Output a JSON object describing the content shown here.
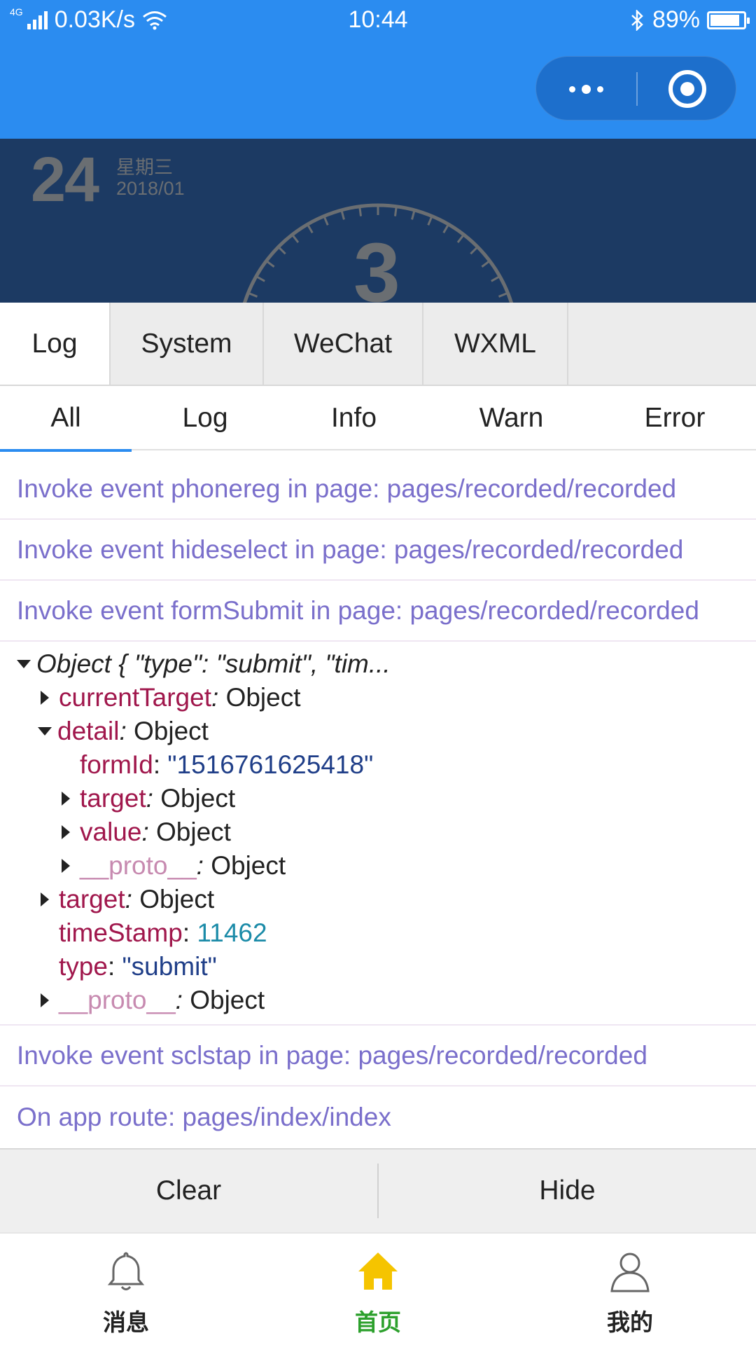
{
  "status_bar": {
    "network_type": "4G",
    "speed": "0.03K/s",
    "time": "10:44",
    "battery": "89%",
    "battery_level": 0.89
  },
  "nav": {
    "more_icon": "more-dots-icon",
    "close_icon": "target-close-icon"
  },
  "banner": {
    "day": "24",
    "weekday": "星期三",
    "date": "2018/01",
    "count": "3"
  },
  "console": {
    "tabs": [
      "Log",
      "System",
      "WeChat",
      "WXML"
    ],
    "subtabs": [
      "All",
      "Log",
      "Info",
      "Warn",
      "Error"
    ],
    "logs_top": [
      "Invoke event phonereg in page: pages/recorded/recorded",
      "Invoke event hideselect in page: pages/recorded/recorded",
      "Invoke event formSubmit in page: pages/recorded/recorded"
    ],
    "object": {
      "summary": "Object { \"type\": \"submit\", \"tim...",
      "currentTarget_key": "currentTarget",
      "currentTarget_val": "Object",
      "detail_key": "detail",
      "detail_val": "Object",
      "formId_key": "formId",
      "formId_val": "\"1516761625418\"",
      "target_key": "target",
      "target_val": "Object",
      "value_key": "value",
      "value_val": "Object",
      "proto_key": "__proto__",
      "proto_val": "Object",
      "target2_key": "target",
      "target2_val": "Object",
      "timeStamp_key": "timeStamp",
      "timeStamp_val": "11462",
      "type_key": "type",
      "type_val": "\"submit\"",
      "proto2_key": "__proto__",
      "proto2_val": "Object"
    },
    "logs_bottom": [
      "Invoke event sclstap in page: pages/recorded/recorded",
      "On app route: pages/index/index"
    ],
    "clear_label": "Clear",
    "hide_label": "Hide"
  },
  "tabbar": {
    "items": [
      {
        "label": "消息",
        "icon": "bell-icon"
      },
      {
        "label": "首页",
        "icon": "home-icon"
      },
      {
        "label": "我的",
        "icon": "user-icon"
      }
    ],
    "active_color": "#2ca02c",
    "home_icon_color": "#f5c400"
  },
  "colors": {
    "nav_blue": "#2b8cf0",
    "banner_navy": "#1c3a63",
    "log_text": "#7a6fcb"
  }
}
